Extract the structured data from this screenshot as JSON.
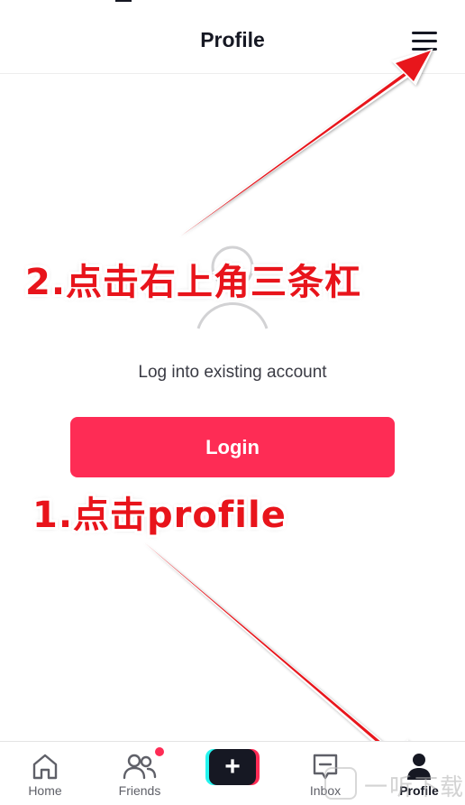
{
  "header": {
    "title": "Profile",
    "menu_icon": "hamburger-menu-icon"
  },
  "main": {
    "avatar_icon": "user-placeholder-icon",
    "caption": "Log into existing account",
    "login_label": "Login"
  },
  "annotations": {
    "step1": "1.点击profile",
    "step2": "2.点击右上角三条杠",
    "color": "#e8141b"
  },
  "tabbar": {
    "tabs": [
      {
        "label": "Home",
        "icon": "home-icon"
      },
      {
        "label": "Friends",
        "icon": "friends-icon",
        "badge": true
      },
      {
        "label": "",
        "icon": "plus-icon"
      },
      {
        "label": "Inbox",
        "icon": "inbox-icon"
      },
      {
        "label": "Profile",
        "icon": "person-icon",
        "active": true
      }
    ]
  },
  "watermark": {
    "text": "一听下载"
  },
  "colors": {
    "accent": "#fe2c55",
    "cyan": "#25f4ee",
    "text": "#161823",
    "muted": "#5f6068"
  }
}
